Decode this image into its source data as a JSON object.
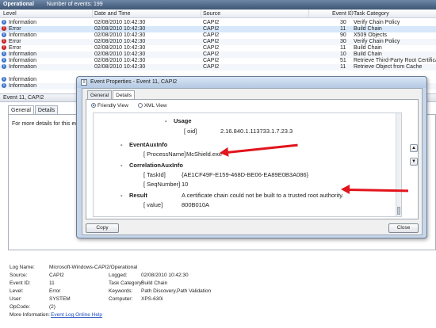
{
  "header": {
    "log_name": "Operational",
    "event_count": "Number of events: 199"
  },
  "columns": {
    "level": "Level",
    "date_time": "Date and Time",
    "source": "Source",
    "event_id": "Event ID",
    "task_category": "Task Category"
  },
  "events": [
    {
      "level": "Information",
      "type": "info",
      "date": "02/08/2010 10:42:30",
      "source": "CAPI2",
      "id": "30",
      "task": "Verify Chain Policy"
    },
    {
      "level": "Error",
      "type": "error",
      "date": "02/08/2010 10:42:30",
      "source": "CAPI2",
      "id": "11",
      "task": "Build Chain"
    },
    {
      "level": "Information",
      "type": "info",
      "date": "02/08/2010 10:42:30",
      "source": "CAPI2",
      "id": "90",
      "task": "X509 Objects"
    },
    {
      "level": "Error",
      "type": "error",
      "date": "02/08/2010 10:42:30",
      "source": "CAPI2",
      "id": "30",
      "task": "Verify Chain Policy"
    },
    {
      "level": "Error",
      "type": "error",
      "date": "02/08/2010 10:42:30",
      "source": "CAPI2",
      "id": "11",
      "task": "Build Chain"
    },
    {
      "level": "Information",
      "type": "info",
      "date": "02/08/2010 10:42:30",
      "source": "CAPI2",
      "id": "10",
      "task": "Build Chain"
    },
    {
      "level": "Information",
      "type": "info",
      "date": "02/08/2010 10:42:30",
      "source": "CAPI2",
      "id": "51",
      "task": "Retrieve Third-Party Root Certifica..."
    },
    {
      "level": "Information",
      "type": "info",
      "date": "02/08/2010 10:42:30",
      "source": "CAPI2",
      "id": "11",
      "task": "Retrieve Object from Cache"
    },
    {
      "level": "Information",
      "type": "info",
      "date": "",
      "source": "",
      "id": "",
      "task": ""
    },
    {
      "level": "Information",
      "type": "info",
      "date": "",
      "source": "",
      "id": "",
      "task": ""
    }
  ],
  "details_header": "Event 11, CAPI2",
  "detail_tabs": {
    "general": "General",
    "details": "Details"
  },
  "description_text": "For more details for this event, pl",
  "event_info": {
    "log_name_label": "Log Name:",
    "log_name": "Microsoft-Windows-CAPI2/Operational",
    "source_label": "Source:",
    "source": "CAPI2",
    "logged_label": "Logged:",
    "logged": "02/08/2010 10:42:30",
    "event_id_label": "Event ID:",
    "event_id": "11",
    "task_label": "Task Category:",
    "task": "Build Chain",
    "level_label": "Level:",
    "level": "Error",
    "keywords_label": "Keywords:",
    "keywords": "Path Discovery,Path Validation",
    "user_label": "User:",
    "user": "SYSTEM",
    "computer_label": "Computer:",
    "computer": "XPS-630i",
    "opcode_label": "OpCode:",
    "opcode": "(2)",
    "more_info_label": "More Information:",
    "more_info_link": "Event Log Online Help"
  },
  "dialog": {
    "title": "Event Properties - Event 11, CAPI2",
    "tabs": {
      "general": "General",
      "details": "Details"
    },
    "views": {
      "friendly": "Friendly View",
      "xml": "XML View"
    },
    "xml": {
      "usage_dash": "-",
      "usage_label": "Usage",
      "oid_key": "[ oid]",
      "oid_value": "2.16.840.1.113733.1.7.23.3",
      "auxinfo_dash": "-",
      "auxinfo_label": "EventAuxInfo",
      "procname_key": "[ ProcessName]",
      "procname_value": "McShield.exe",
      "correl_dash": "-",
      "correl_label": "CorrelationAuxInfo",
      "taskid_key": "[ TaskId]",
      "taskid_value": "{AE1CF49F-E159-468D-BE06-EA89E0B3A086}",
      "seq_key": "[ SeqNumber]",
      "seq_value": "10",
      "result_dash": "-",
      "result_label": "Result",
      "result_text": "A certificate chain could not be built to a trusted root authority.",
      "value_key": "[ value]",
      "value_value": "800B010A"
    },
    "copy_label": "Copy",
    "close_label": "Close"
  },
  "colors": {
    "annotation_arrow": "#e2141c",
    "error_icon": "#c62222",
    "info_icon": "#3d73c9"
  }
}
